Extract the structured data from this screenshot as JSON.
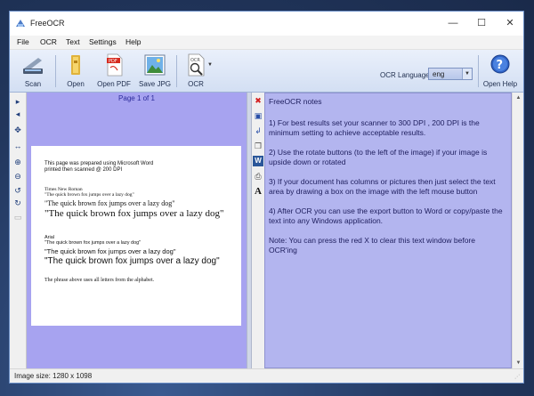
{
  "window": {
    "title": "FreeOCR",
    "controls": {
      "minimize": "—",
      "maximize": "☐",
      "close": "✕"
    }
  },
  "menu": [
    "File",
    "OCR",
    "Text",
    "Settings",
    "Help"
  ],
  "toolbar": {
    "buttons": [
      {
        "label": "Scan",
        "icon": "scanner-icon"
      },
      {
        "label": "Open",
        "icon": "folder-icon"
      },
      {
        "label": "Open PDF",
        "icon": "pdf-icon"
      },
      {
        "label": "Save JPG",
        "icon": "picture-icon"
      },
      {
        "label": "OCR",
        "icon": "ocr-icon"
      }
    ],
    "ocr_language_label": "OCR Language:",
    "ocr_language_value": "eng",
    "help_label": "Open Help"
  },
  "image_pane": {
    "page_label": "Page 1 of 1",
    "document": {
      "intro_line1": "This page was prepared using Microsoft Word",
      "intro_line2": "printed then scanned @ 200 DPI",
      "font1_name": "Times New Roman",
      "font1_s1": "\"The quick brown fox jumps over a lazy dog\"",
      "font1_s2": "\"The quick brown fox jumps over a lazy dog\"",
      "font1_s3": "\"The quick brown fox jumps over a lazy dog\"",
      "font2_name": "Arial",
      "font2_s1": "\"The quick brown fox jumps over a lazy dog\"",
      "font2_s2": "\"The quick brown fox jumps over a lazy dog\"",
      "font2_s3": "\"The quick brown fox jumps over a lazy dog\"",
      "closing": "The phrase above uses all letters from the alphabet."
    }
  },
  "text_pane": {
    "lines": [
      "FreeOCR notes",
      "",
      "1) For best results set your scanner to 300 DPI , 200 DPI is the",
      "minimum setting to achieve acceptable results.",
      "",
      "2) Use the rotate buttons (to the left of the image) if your image is",
      "upside down or rotated",
      "",
      "3) If your document has columns or pictures then just select the text",
      "area by drawing a box on the image with the left mouse button",
      "",
      "4) After OCR you can use the export button to Word or copy/paste the",
      "text into any Windows application.",
      "",
      "Note: You can press the red X to clear this text window before",
      "OCR'ing"
    ]
  },
  "status": {
    "image_size": "Image size:  1280 x 1098"
  },
  "colors": {
    "image_pane_bg": "#a7a3f0",
    "text_pane_bg": "#b3b5ef",
    "text_color": "#202060"
  }
}
